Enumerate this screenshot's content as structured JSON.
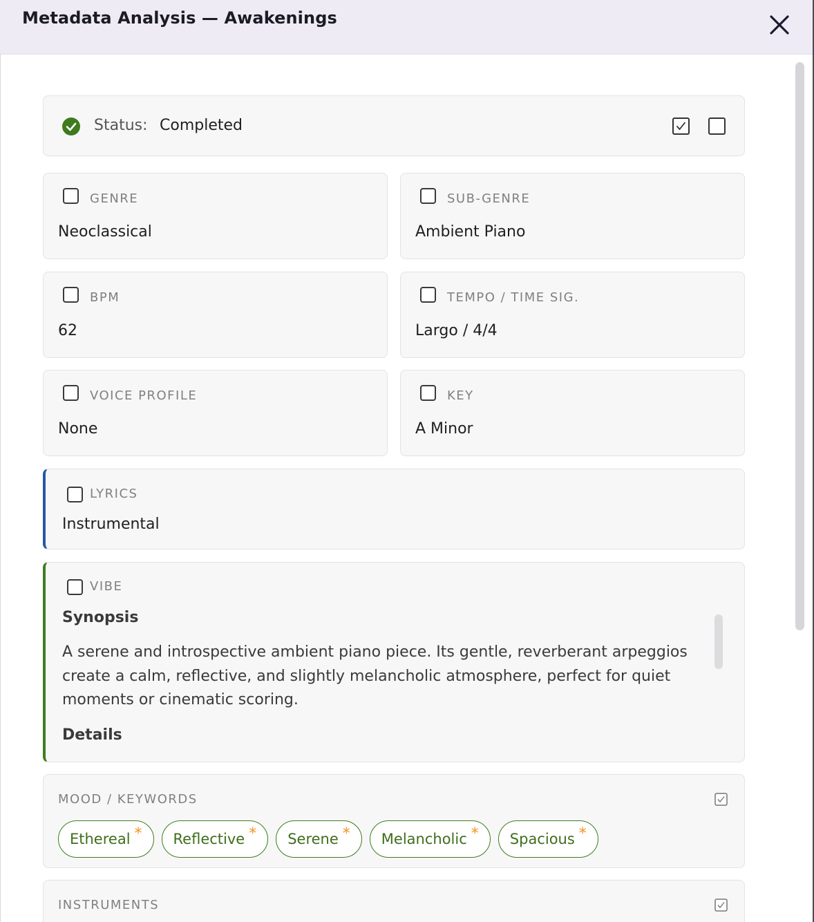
{
  "header": {
    "title": "Metadata Analysis — Awakenings"
  },
  "status": {
    "label": "Status:",
    "value": "Completed"
  },
  "fields": {
    "genre": {
      "label": "GENRE",
      "value": "Neoclassical"
    },
    "sub_genre": {
      "label": "SUB-GENRE",
      "value": "Ambient Piano"
    },
    "bpm": {
      "label": "BPM",
      "value": "62"
    },
    "tempo": {
      "label": "TEMPO / TIME SIG.",
      "value": "Largo / 4/4"
    },
    "voice_profile": {
      "label": "VOICE PROFILE",
      "value": "None"
    },
    "key": {
      "label": "KEY",
      "value": "A Minor"
    },
    "lyrics": {
      "label": "LYRICS",
      "value": "Instrumental"
    }
  },
  "vibe": {
    "label": "VIBE",
    "synopsis_heading": "Synopsis",
    "synopsis_text": "A serene and introspective ambient piano piece. Its gentle, reverberant arpeggios create a calm, reflective, and slightly melancholic atmosphere, perfect for quiet moments or cinematic scoring.",
    "details_heading": "Details"
  },
  "mood": {
    "label": "MOOD / KEYWORDS",
    "tags": [
      {
        "text": "Ethereal",
        "star": "*"
      },
      {
        "text": "Reflective",
        "star": "*"
      },
      {
        "text": "Serene",
        "star": "*"
      },
      {
        "text": "Melancholic",
        "star": "*"
      },
      {
        "text": "Spacious",
        "star": "*"
      }
    ]
  },
  "instruments": {
    "label": "INSTRUMENTS"
  },
  "colors": {
    "accent_green": "#3e7d1f",
    "accent_blue": "#2757a8",
    "star_orange": "#f39420",
    "header_bg": "#eeebf5"
  },
  "icons": {
    "close": "close-icon",
    "status": "check-circle-icon"
  }
}
